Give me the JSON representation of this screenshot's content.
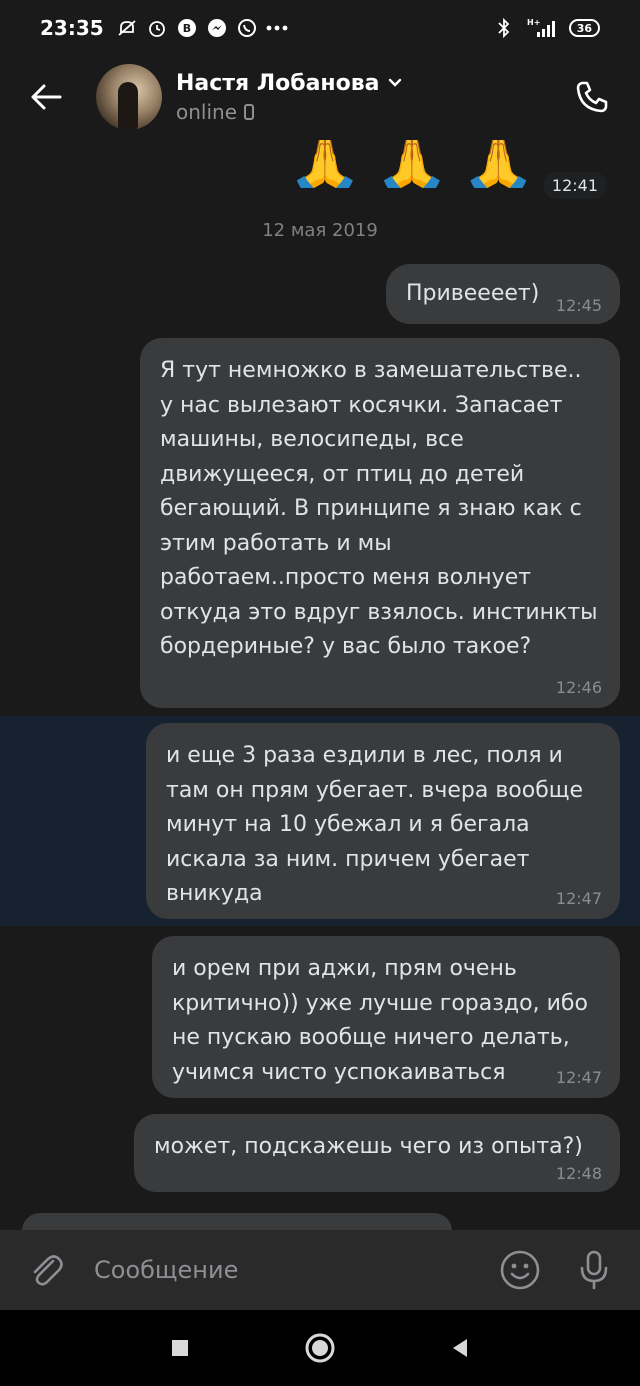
{
  "status_bar": {
    "time": "23:35",
    "network": "H+",
    "battery": "36"
  },
  "header": {
    "contact_name": "Настя Лобанова",
    "contact_status": "online"
  },
  "chat": {
    "emoji_message": {
      "emojis": [
        "🙏",
        "🙏",
        "🙏"
      ],
      "time": "12:41"
    },
    "date_separator": "12 мая 2019",
    "messages": [
      {
        "text": "Привеееет)",
        "time": "12:45"
      },
      {
        "text": "Я тут немножко в замешательстве.. у нас вылезают косячки. Запасает машины, велосипеды, все движущееся, от птиц до детей бегающий. В принципе я знаю как с этим работать и мы работаем..просто меня волнует откуда это вдруг взялось. инстинкты бордериные? у вас было такое?",
        "time": "12:46"
      },
      {
        "text": "и еще 3 раза ездили в лес, поля и там он прям убегает. вчера вообще минут на 10 убежал и я бегала искала за ним. причем убегает вникуда",
        "time": "12:47"
      },
      {
        "text": "и орем при аджи, прям очень критично)) уже лучше гораздо, ибо не пускаю вообще ничего делать, учимся чисто успокаиваться",
        "time": "12:47"
      },
      {
        "text": "может, подскажешь чего из опыта?)",
        "time": "12:48"
      }
    ]
  },
  "composer": {
    "placeholder": "Сообщение"
  },
  "colors": {
    "background": "#1a1a1a",
    "bubble": "#3a3b3d",
    "highlight": "#172230",
    "composer": "#2a2a2b"
  }
}
